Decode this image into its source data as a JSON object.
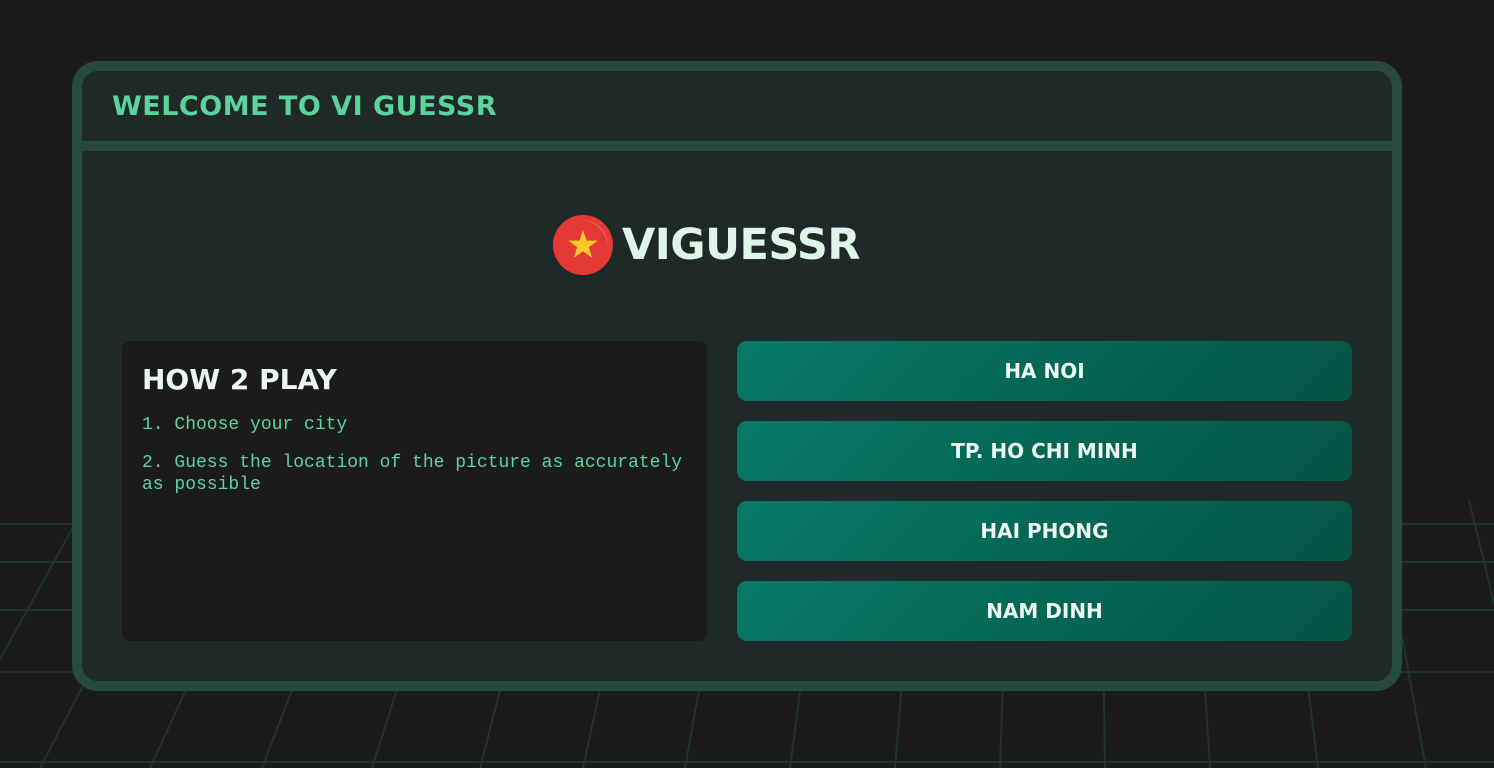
{
  "window": {
    "title": "WELCOME TO VI GUESSR"
  },
  "logo": {
    "text": "VIGUESSR",
    "icon": "vietnam-flag-icon"
  },
  "how_to_play": {
    "title": "HOW 2 PLAY",
    "steps": [
      "1. Choose your city",
      "2. Guess the location of the picture as accurately as possible"
    ]
  },
  "cities": [
    {
      "label": "HA NOI"
    },
    {
      "label": "TP. HO CHI MINH"
    },
    {
      "label": "HAI PHONG"
    },
    {
      "label": "NAM DINH"
    }
  ],
  "colors": {
    "background": "#1b1b1b",
    "window_border": "#274a3e",
    "window_bg": "#1f2a28",
    "accent_green": "#5bd39c",
    "button_gradient_start": "#077a66",
    "button_gradient_end": "#035445",
    "flag_red": "#e53935",
    "flag_star": "#ffca28"
  }
}
